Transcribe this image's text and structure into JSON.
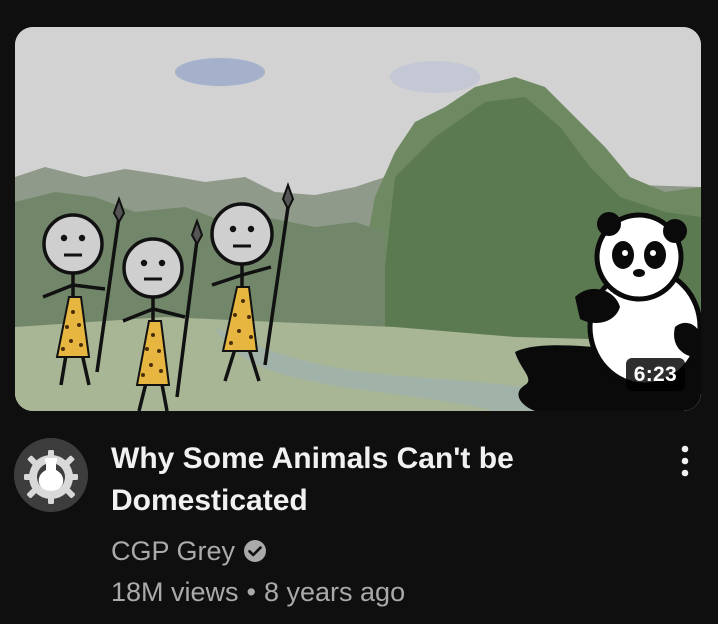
{
  "video": {
    "title": "Why Some Animals Can't be Domesticated",
    "duration": "6:23",
    "thumbnail_icon": "video-thumbnail"
  },
  "channel": {
    "name": "CGP Grey",
    "verified": true,
    "avatar_icon": "cgp-grey-logo-icon",
    "verified_icon": "verified-check-icon"
  },
  "stats": {
    "views": "18M views",
    "separator": "•",
    "age": "8 years ago"
  },
  "menu": {
    "icon": "more-vert-icon"
  },
  "colors": {
    "background": "#0f0f0f",
    "title": "#f1f1f1",
    "secondary_text": "#aaaaaa",
    "duration_bg": "#000000",
    "stickman_tunic": "#e6b640"
  }
}
